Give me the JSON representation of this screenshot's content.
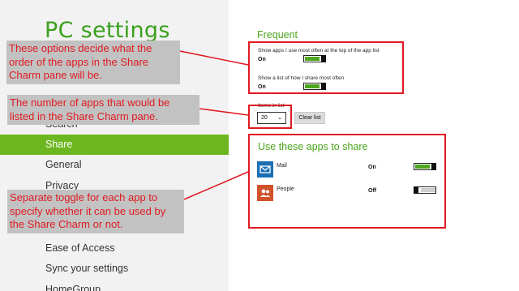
{
  "left_pane": {
    "title": "PC settings",
    "nav_items": [
      "Search",
      "Share",
      "General",
      "Privacy",
      "Ease of Access",
      "Sync your settings",
      "HomeGroup"
    ],
    "selected_index": 1
  },
  "frequent": {
    "heading": "Frequent",
    "option1_label": "Show apps I use most often at the top of the app list",
    "option1_state": "On",
    "option2_label": "Show a list of how I share most often",
    "option2_state": "On",
    "items_label": "Items in list",
    "items_value": "20",
    "clear_button": "Clear list"
  },
  "apps_section": {
    "heading": "Use these apps to share",
    "apps": [
      {
        "name": "Mail",
        "state": "On",
        "icon": "mail-icon",
        "color": "#1b6fb5"
      },
      {
        "name": "People",
        "state": "Off",
        "icon": "people-icon",
        "color": "#d0522b"
      }
    ]
  },
  "callouts": {
    "top": "These options decide what the order of the apps in the Share Charm pane will be.",
    "middle": "The number of apps that would be listed in the Share Charm pane.",
    "bottom": "Separate toggle for each app to specify whether it can be used by the Share Charm or not."
  },
  "colors": {
    "accent_green": "#6cb61f",
    "annotation_red": "#e01a22",
    "callout_bg": "#c2c2c2"
  }
}
